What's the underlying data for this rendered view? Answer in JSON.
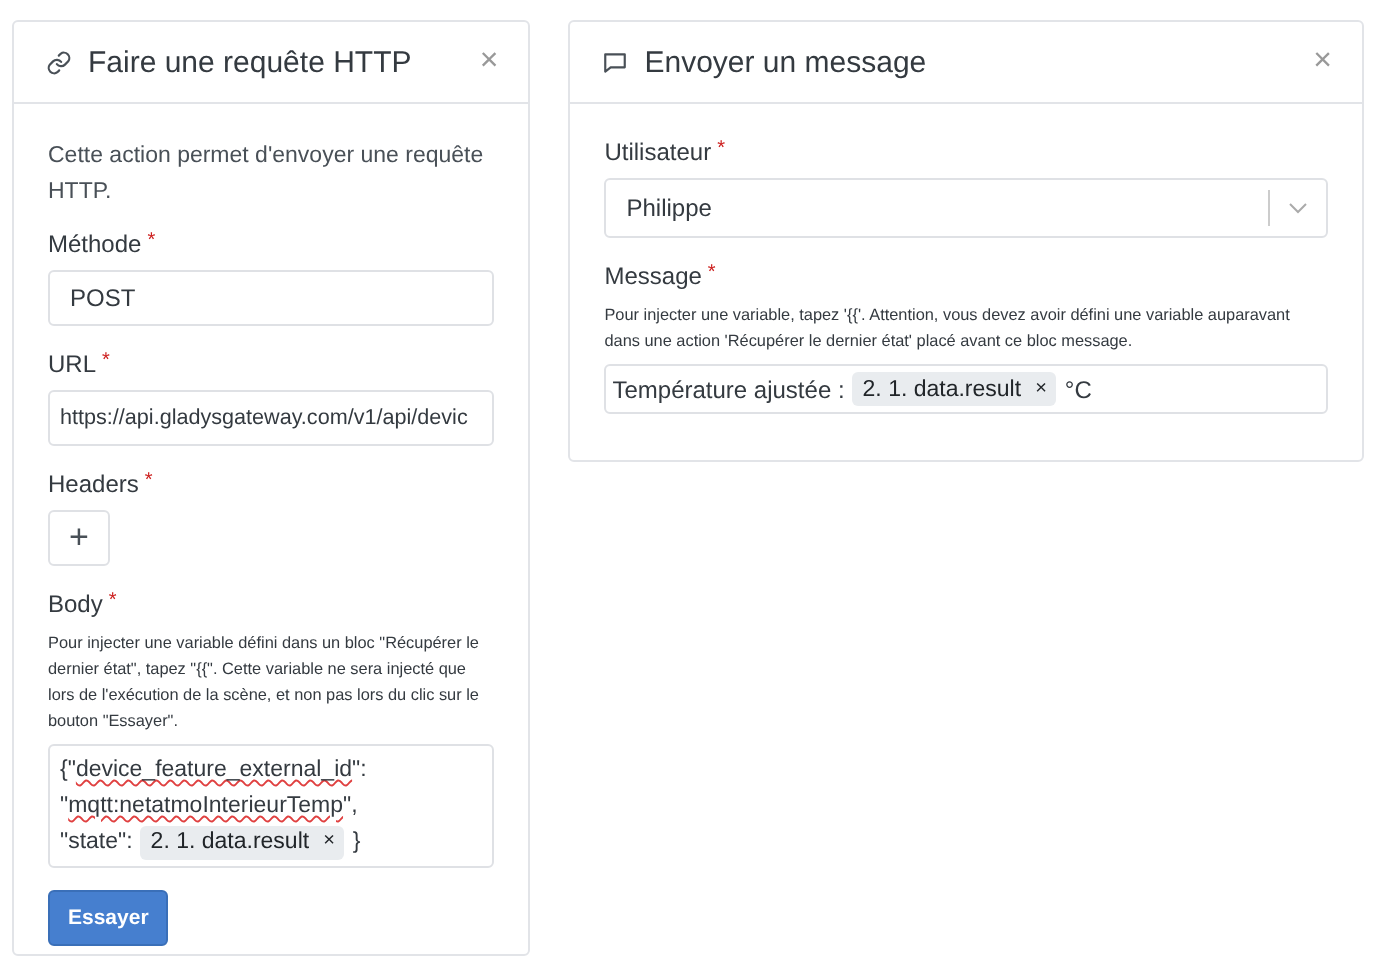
{
  "http_card": {
    "title": "Faire une requête HTTP",
    "close": "×",
    "description": "Cette action permet d'envoyer une requête HTTP.",
    "method": {
      "label": "Méthode",
      "required": "*",
      "value": "POST"
    },
    "url": {
      "label": "URL",
      "required": "*",
      "value": "https://api.gladysgateway.com/v1/api/devic"
    },
    "headers": {
      "label": "Headers",
      "required": "*",
      "add": "+"
    },
    "body": {
      "label": "Body",
      "required": "*",
      "hint": "Pour injecter une variable défini dans un bloc \"Récupérer le dernier état\", tapez \"{{\". Cette variable ne sera injecté que lors de l'exécution de la scène, et non pas lors du clic sur le bouton \"Essayer\".",
      "lines": [
        [
          {
            "kind": "text",
            "text": "{\""
          },
          {
            "kind": "misspelled",
            "text": "device_feature_external_id"
          },
          {
            "kind": "text",
            "text": "\":"
          }
        ],
        [
          {
            "kind": "text",
            "text": "\""
          },
          {
            "kind": "misspelled",
            "text": "mqtt:netatmoInterieurTemp"
          },
          {
            "kind": "text",
            "text": "\","
          }
        ],
        [
          {
            "kind": "text",
            "text": "\"state\":"
          },
          {
            "kind": "tag",
            "text": "2. 1. data.result",
            "remove": "×"
          },
          {
            "kind": "text",
            "text": "}"
          }
        ]
      ]
    },
    "button": "Essayer"
  },
  "message_card": {
    "title": "Envoyer un message",
    "close": "×",
    "user": {
      "label": "Utilisateur",
      "required": "*",
      "value": "Philippe"
    },
    "message": {
      "label": "Message",
      "required": "*",
      "hint": "Pour injecter une variable, tapez '{{'. Attention, vous devez avoir défini une variable auparavant dans une action 'Récupérer le dernier état' placé avant ce bloc message.",
      "segments": [
        {
          "kind": "text",
          "text": "Température ajustée :"
        },
        {
          "kind": "tag",
          "text": "2. 1. data.result",
          "remove": "×"
        },
        {
          "kind": "text",
          "text": "°C"
        }
      ]
    }
  }
}
